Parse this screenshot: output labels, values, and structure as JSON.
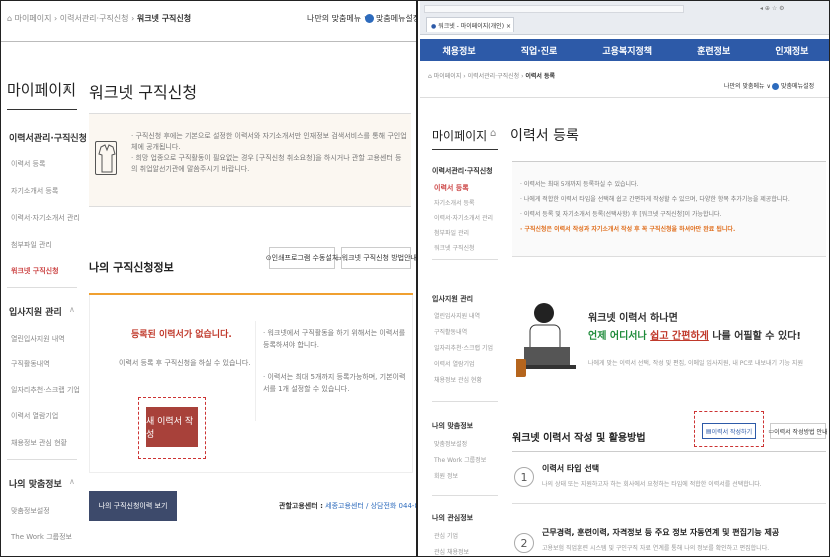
{
  "left": {
    "breadcrumb": {
      "home": "홈",
      "sep1": "마이페이지",
      "sep2": "이력서관리·구직신청",
      "current": "워크넷 구직신청"
    },
    "top_user": "나만의 맞춤메뉴",
    "top_menu": "맞춤메뉴설정",
    "side": {
      "title": "마이페이지",
      "groups": [
        {
          "heading": "이력서관리·구직신청",
          "items": [
            "이력서 등록",
            "자기소개서 등록",
            "이력서·자기소개서 관리",
            "첨부파일 관리",
            "워크넷 구직신청"
          ]
        },
        {
          "heading": "입사지원 관리",
          "items": [
            "열린입사지원 내역",
            "구직활동내역",
            "일자리추천·스크랩 기업",
            "이력서 열람기업",
            "채용정보 관심 현황"
          ]
        },
        {
          "heading": "나의 맞춤정보",
          "items": [
            "맞춤정보설정",
            "The Work 그룹정보"
          ]
        }
      ]
    },
    "page_title": "워크넷 구직신청",
    "info_lines": [
      "구직신청 후에는 기본으로 설정한 이력서와 자기소개서만 인재정보 검색서비스를 통해 구인업체에 공개됩니다.",
      "희망 업종으로 구직활동이 필요없는 경우 [구직신청 취소요청]을 하시거나 관할 고용센터 등의 취업알선기관에 말씀주시기 바랍니다."
    ],
    "section_title": "나의 구직신청정보",
    "btn_program": "인쇄프로그램 수동설치",
    "btn_guide": "워크넷 구직신청 방법안내",
    "empty_title": "등록된 이력서가 없습니다.",
    "empty_desc": "이력서 등록 후 구직신청을 하실 수 있습니다.",
    "notes": [
      "워크넷에서 구직활동을 하기 위해서는 이력서를 등록하셔야 합니다.",
      "이력서는 최대 5개까지 등록가능하며, 기본이력서를 1개 설정할 수 있습니다."
    ],
    "new_resume": "새 이력서 작성",
    "bottom_btn": "나의 구직신청이력 보기",
    "center_label": "관할고용센터 :",
    "center_value": "세종고용센터 / 상담전화 044-865-3219"
  },
  "right": {
    "tab_title": "워크넷 - 마이페이지(개인)",
    "nav": [
      "채용정보",
      "직업·진로",
      "고용복지정책",
      "훈련정보",
      "인재정보"
    ],
    "breadcrumb": {
      "home": "홈",
      "sep1": "마이페이지",
      "sep2": "이력서관리·구직신청",
      "current": "이력서 등록"
    },
    "top_user": "나만의 맞춤메뉴",
    "top_menu": "맞춤메뉴설정",
    "side": {
      "title": "마이페이지",
      "groups": [
        {
          "heading": "이력서관리·구직신청",
          "items": [
            "이력서 등록",
            "자기소개서 등록",
            "이력서·자기소개서 관리",
            "첨부파일 관리",
            "워크넷 구직신청"
          ]
        },
        {
          "heading": "입사지원 관리",
          "items": [
            "열린입사지원 내역",
            "구직활동내역",
            "일자리추천·스크랩 기업",
            "이력서 열람기업",
            "채용정보 관심 현황"
          ]
        },
        {
          "heading": "나의 맞춤정보",
          "items": [
            "맞춤정보설정",
            "The Work 그룹정보",
            "회원 정보"
          ]
        },
        {
          "heading": "나의 관심정보",
          "items": [
            "관심 기업",
            "관심 채용정보"
          ]
        }
      ]
    },
    "page_title": "이력서 등록",
    "notices": [
      "이력서는 최대 5개까지 등록하실 수 있습니다.",
      "나에게 적합한 이력서 타입을 선택해 쉽고 간편하게 작성할 수 있으며, 다양한 항목 추가기능을 제공합니다.",
      "이력서 등록 및 자기소개서 등록(선택사항) 후 [워크넷 구직신청]이 가능합니다.",
      "구직신청은 이력서 작성과 자기소개서 작성 후 꼭 구직신청을 하셔야만 완료 됩니다."
    ],
    "promo_line1": "워크넷 이력서 하나면",
    "promo_line2_a": "언제 어디서나",
    "promo_line2_b": "쉽고 간편하게",
    "promo_line2_c": "나를 어필할 수 있다!",
    "promo_desc": "나에게 맞는 이력서 선택, 작성 및 편집, 이메일 입사지원, 내 PC로 내보내기 기능 지원",
    "section_title": "워크넷 이력서 작성 및 활용방법",
    "btn_write": "이력서 작성하기",
    "btn_guide": "이력서 작성방법 안내",
    "steps": [
      {
        "num": "1",
        "title": "이력서 타입 선택",
        "desc": "나의 상태 또는 지원하고자 하는 회사에서 요청하는 타입에 적합한 이력서를 선택합니다."
      },
      {
        "num": "2",
        "title": "근무경력, 훈련이력, 자격정보 등 주요 정보 자동연계 및 편집기능 제공",
        "desc": "고용보험 직업훈련 시스템 및 구인구직 자료 연계를 통해 나의 정보를 확인하고 편집합니다."
      }
    ],
    "colors": {
      "nav": "#2d5aa8",
      "accent_red": "#c0392b",
      "accent_green": "#1e8b3a"
    }
  }
}
